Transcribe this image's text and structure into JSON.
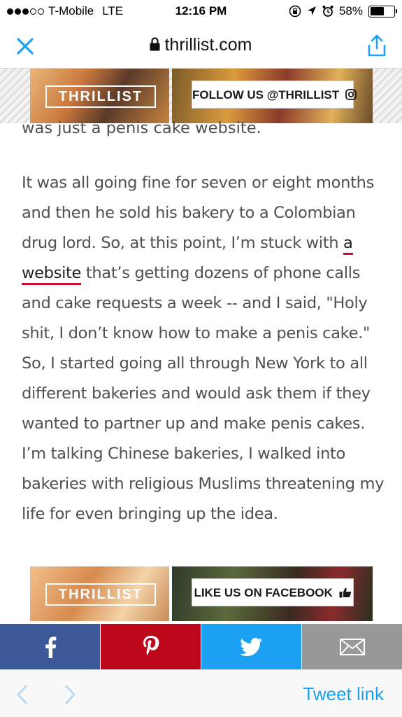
{
  "status_bar": {
    "carrier": "T-Mobile",
    "network": "LTE",
    "time": "12:16 PM",
    "battery": "58%",
    "battery_level": 0.58
  },
  "nav": {
    "url": "thrillist.com"
  },
  "ads": [
    {
      "logo": "THRILLIST",
      "cta": "FOLLOW US @THRILLIST",
      "cta_icon": "instagram-icon"
    },
    {
      "logo": "THRILLIST",
      "cta": "LIKE US ON FACEBOOK",
      "cta_icon": "thumbs-up-icon"
    }
  ],
  "article": {
    "previous_line": "was just a penis cake website.",
    "para_before_link": "It was all going fine for seven or eight months and then he sold his bakery to a Colombian drug lord. So, at this point, I’m stuck with ",
    "link_text": "a website",
    "para_after_link": " that’s getting dozens of phone calls and cake requests a week -- and I said, \"Holy shit, I don’t know how to make a penis cake.\" So, I started going all through New York to all different bakeries and would ask them if they wanted to partner up and make penis cakes. I’m talking Chinese bakeries, I walked into bakeries with religious Muslims threatening my life for even bringing up the idea."
  },
  "share_bar": [
    {
      "name": "facebook",
      "icon": "facebook-icon",
      "color": "#3b5998"
    },
    {
      "name": "pinterest",
      "icon": "pinterest-icon",
      "color": "#bd081c"
    },
    {
      "name": "twitter",
      "icon": "twitter-icon",
      "color": "#1da1f2"
    },
    {
      "name": "email",
      "icon": "mail-icon",
      "color": "#999999"
    }
  ],
  "toolbar": {
    "tweet_link_label": "Tweet link"
  },
  "colors": {
    "accent": "#1da1f2",
    "link_underline": "#c8102e",
    "body_text": "#505050"
  }
}
